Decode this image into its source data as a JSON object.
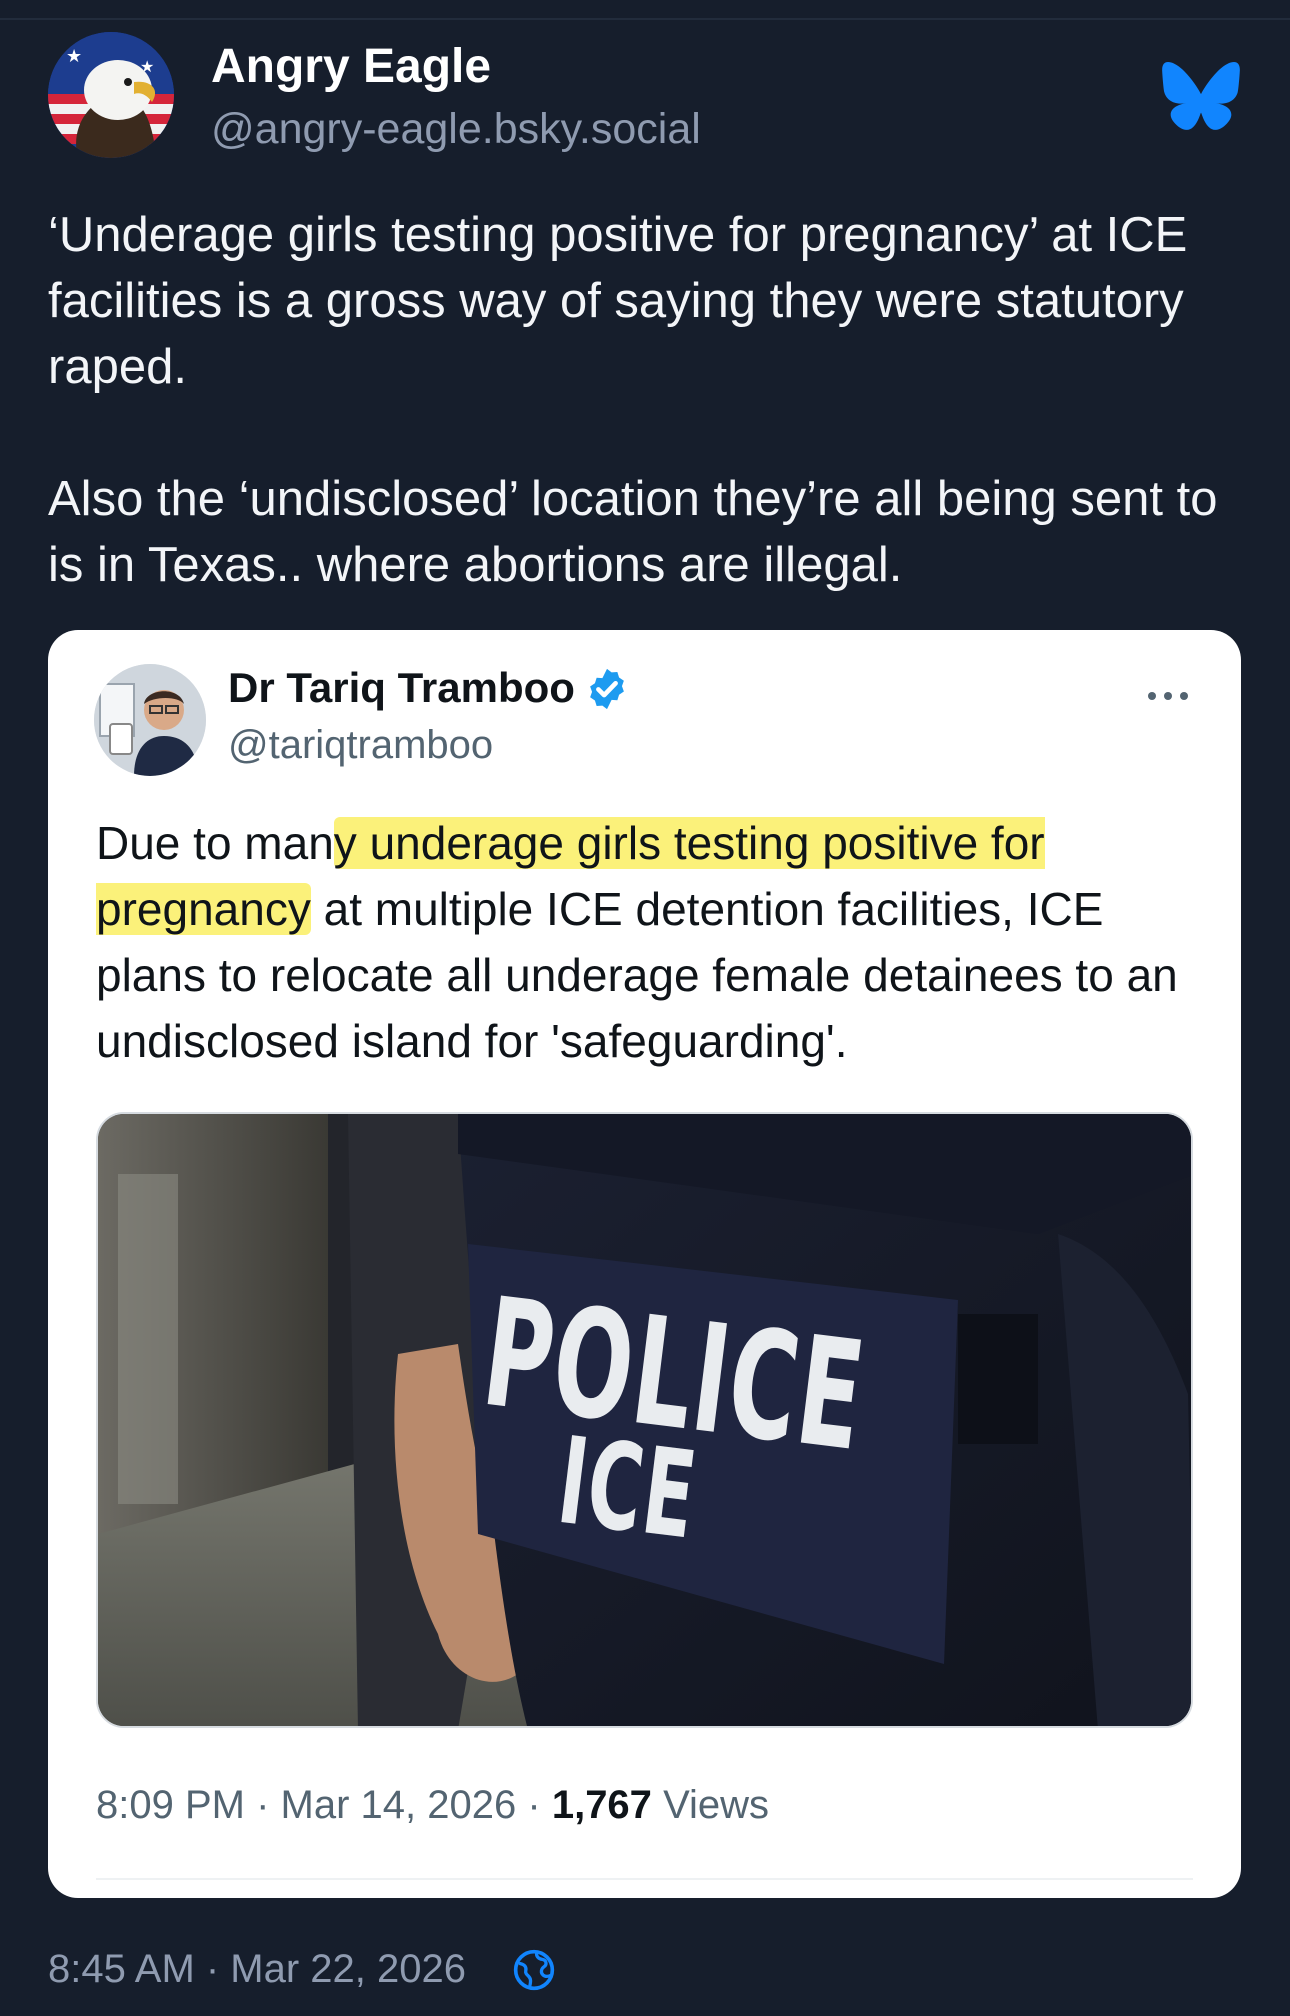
{
  "author": {
    "name": "Angry Eagle",
    "handle": "@angry-eagle.bsky.social",
    "avatar_icon": "bald-eagle-flag-avatar"
  },
  "platform_icon": "bluesky-butterfly-icon",
  "post": {
    "paragraphs": [
      "‘Underage girls testing positive for pregnancy’ at ICE facilities is a gross way of saying they were statutory raped.",
      "Also the ‘undisclosed’ location they’re all being sent to is in Texas.. where abortions are illegal."
    ],
    "timestamp": "8:45 AM · Mar 22, 2026",
    "visibility_icon": "globe-icon"
  },
  "embedded_tweet": {
    "name": "Dr Tariq Tramboo",
    "handle": "@tariqtramboo",
    "verified_icon": "verified-badge-icon",
    "text_before": "Due to man",
    "text_highlight": "y underage girls testing positive for pregnancy",
    "text_after": " at multiple ICE detention facilities, ICE plans to relocate all underage female detainees to an undisclosed island for 'safeguarding'.",
    "image": {
      "vest_line1": "POLICE",
      "vest_line2": "ICE"
    },
    "time": "8:09 PM",
    "date": "Mar 14, 2026",
    "views_count": "1,767",
    "views_label": "Views"
  },
  "colors": {
    "background": "#161e2c",
    "bluesky_blue": "#1185fe",
    "verified_blue": "#1d9bf0",
    "highlight_yellow": "#fbf17a"
  }
}
